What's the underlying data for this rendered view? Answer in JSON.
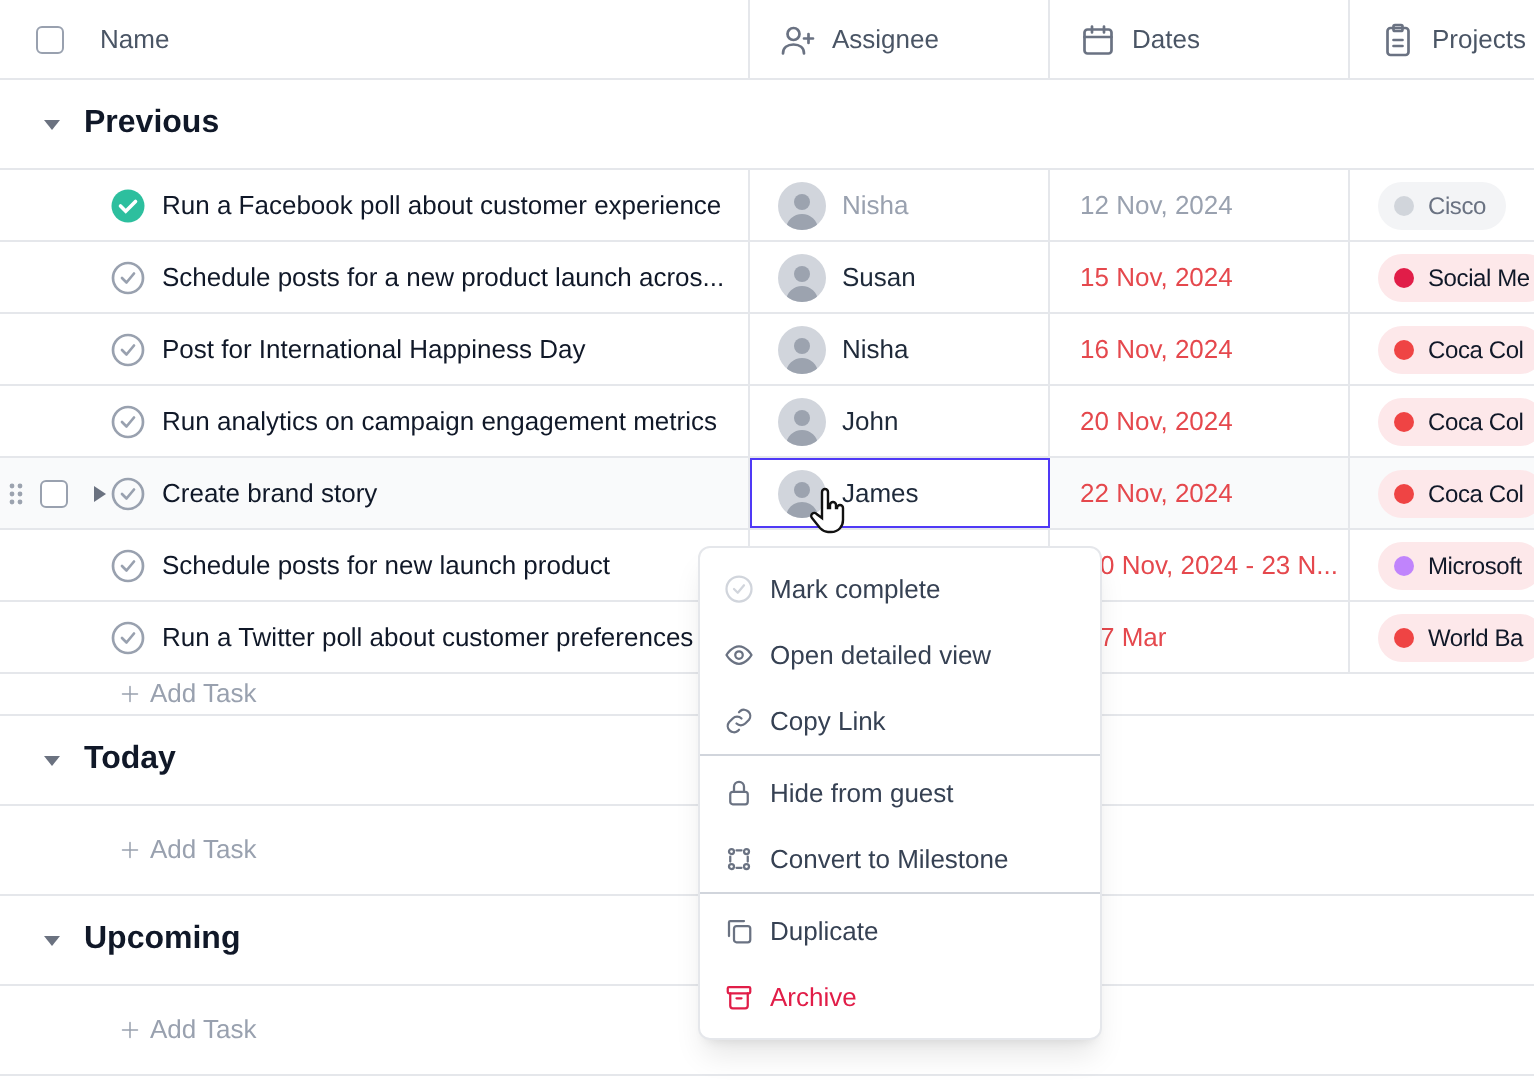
{
  "header": {
    "select_all_checked": false,
    "columns": [
      {
        "kind": "name",
        "label": "Name"
      },
      {
        "kind": "assignee",
        "label": "Assignee"
      },
      {
        "kind": "dates",
        "label": "Dates"
      },
      {
        "kind": "projects",
        "label": "Projects"
      }
    ]
  },
  "groups": [
    {
      "title": "Previous",
      "expanded": true,
      "add_label": "Add Task",
      "tasks": [
        {
          "name": "Run a Facebook poll about customer experience",
          "completed": true,
          "hovered": false,
          "assignee": "Nisha",
          "date": "12 Nov, 2024",
          "project": "Cisco",
          "color": "#d1d5db"
        },
        {
          "name": "Schedule posts for a new product launch acros...",
          "completed": false,
          "hovered": false,
          "assignee": "Susan",
          "date": "15 Nov, 2024",
          "overdue": true,
          "project": "Social Me",
          "color": "#e11d48"
        },
        {
          "name": "Post for International Happiness Day",
          "completed": false,
          "hovered": false,
          "assignee": "Nisha",
          "date": "16 Nov, 2024",
          "overdue": true,
          "project": "Coca Col",
          "color": "#ef4444"
        },
        {
          "name": "Run analytics on campaign engagement metrics",
          "completed": false,
          "hovered": false,
          "assignee": "John",
          "date": "20 Nov, 2024",
          "overdue": true,
          "project": "Coca Col",
          "color": "#ef4444"
        },
        {
          "name": "Create brand story",
          "completed": false,
          "hovered": true,
          "assignee": "James",
          "assignee_focused": true,
          "date": "22 Nov, 2024",
          "overdue": true,
          "project": "Coca Col",
          "color": "#ef4444"
        },
        {
          "name": "Schedule posts for new launch product",
          "completed": false,
          "hovered": false,
          "date": "0 Nov, 2024 - 23 N...",
          "overdue": true,
          "under_menu": true,
          "project": "Microsoft",
          "color": "#c084fc"
        },
        {
          "name": "Run a Twitter poll about customer preferences",
          "completed": false,
          "hovered": false,
          "date": "7 Mar",
          "overdue": true,
          "under_menu": true,
          "project": "World Ba",
          "color": "#ef4444"
        }
      ]
    },
    {
      "title": "Today",
      "expanded": true,
      "add_label": "Add Task"
    },
    {
      "title": "Upcoming",
      "expanded": true,
      "add_label": "Add Task"
    }
  ],
  "context_menu": {
    "sections": [
      [
        {
          "kind": "complete",
          "label": "Mark complete"
        },
        {
          "kind": "view",
          "label": "Open detailed view"
        },
        {
          "kind": "link",
          "label": "Copy Link"
        }
      ],
      [
        {
          "kind": "lock",
          "label": "Hide from guest"
        },
        {
          "kind": "milestone",
          "label": "Convert to Milestone"
        }
      ],
      [
        {
          "kind": "duplicate",
          "label": "Duplicate"
        },
        {
          "kind": "archive",
          "label": "Archive",
          "danger": true
        }
      ]
    ]
  }
}
